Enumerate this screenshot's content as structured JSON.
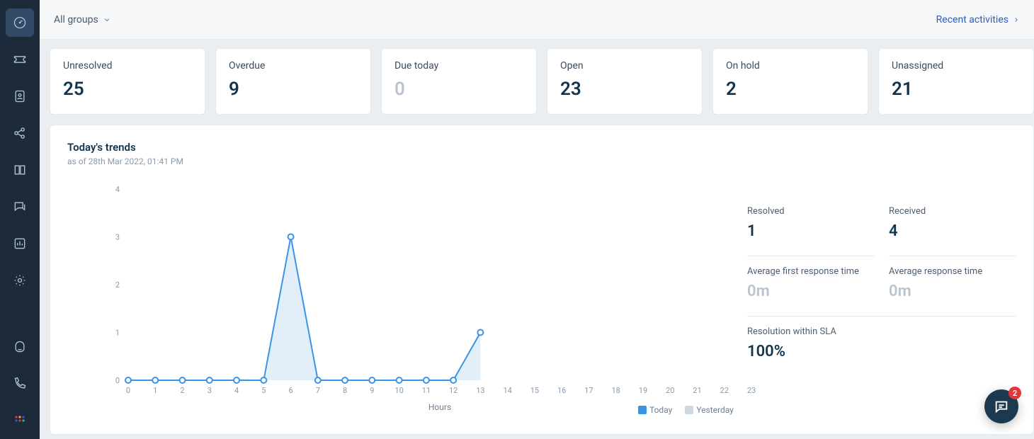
{
  "sidebar": {
    "items": [
      {
        "name": "dashboard-icon"
      },
      {
        "name": "ticket-icon"
      },
      {
        "name": "contacts-icon"
      },
      {
        "name": "social-icon"
      },
      {
        "name": "solutions-icon"
      },
      {
        "name": "forums-icon"
      },
      {
        "name": "analytics-icon"
      },
      {
        "name": "admin-icon"
      }
    ],
    "bottom": [
      {
        "name": "freddy-icon"
      },
      {
        "name": "phone-icon"
      },
      {
        "name": "apps-icon"
      }
    ]
  },
  "header": {
    "filter_label": "All groups",
    "recent_label": "Recent activities"
  },
  "cards": [
    {
      "label": "Unresolved",
      "value": "25",
      "muted": false
    },
    {
      "label": "Overdue",
      "value": "9",
      "muted": false
    },
    {
      "label": "Due today",
      "value": "0",
      "muted": true
    },
    {
      "label": "Open",
      "value": "23",
      "muted": false
    },
    {
      "label": "On hold",
      "value": "2",
      "muted": false
    },
    {
      "label": "Unassigned",
      "value": "21",
      "muted": false
    }
  ],
  "trends": {
    "title": "Today's trends",
    "subtitle": "as of 28th Mar 2022, 01:41 PM",
    "x_title": "Hours",
    "legend_today": "Today",
    "legend_yesterday": "Yesterday"
  },
  "chart_data": {
    "type": "line",
    "xlabel": "Hours",
    "ylabel": "",
    "ylim": [
      0,
      4
    ],
    "x_ticks": [
      0,
      1,
      2,
      3,
      4,
      5,
      6,
      7,
      8,
      9,
      10,
      11,
      12,
      13,
      14,
      15,
      16,
      17,
      18,
      19,
      20,
      21,
      22,
      23
    ],
    "y_ticks": [
      0,
      1,
      2,
      3,
      4
    ],
    "series": [
      {
        "name": "Today",
        "color": "#3a94e6",
        "values": [
          0,
          0,
          0,
          0,
          0,
          0,
          3,
          0,
          0,
          0,
          0,
          0,
          0,
          1
        ],
        "visible_through_x": 12,
        "last_partial": true
      },
      {
        "name": "Yesterday",
        "color": "#d0d8df",
        "values": []
      }
    ]
  },
  "stats": [
    {
      "label": "Resolved",
      "value": "1",
      "muted": false
    },
    {
      "label": "Received",
      "value": "4",
      "muted": false
    },
    {
      "label": "Average first response time",
      "value": "0m",
      "muted": true
    },
    {
      "label": "Average response time",
      "value": "0m",
      "muted": true
    },
    {
      "label": "Resolution within SLA",
      "value": "100%",
      "muted": false,
      "full": true
    }
  ],
  "chat": {
    "badge": "2"
  }
}
